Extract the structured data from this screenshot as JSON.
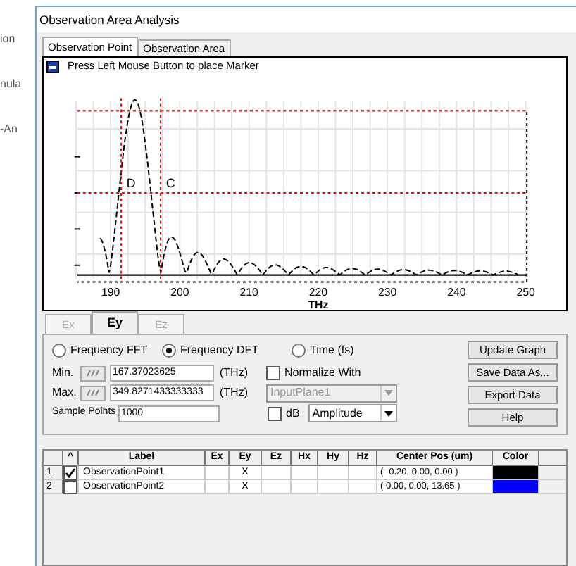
{
  "background_window": {
    "texts": [
      "ion",
      "nula",
      "-An"
    ]
  },
  "window": {
    "title": "Observation Area Analysis"
  },
  "tabs": [
    {
      "label": "Observation Point",
      "selected": true
    },
    {
      "label": "Observation Area",
      "selected": false
    }
  ],
  "graph": {
    "hint": "Press Left Mouse Button to place Marker",
    "x_tick_labels": [
      "190",
      "200",
      "210",
      "220",
      "230",
      "240",
      "250"
    ],
    "x_axis_label": "THz",
    "markers": [
      {
        "label": "D"
      },
      {
        "label": "C"
      }
    ]
  },
  "field_tabs": [
    {
      "label": "Ex",
      "selected": false,
      "disabled": true
    },
    {
      "label": "Ey",
      "selected": true,
      "disabled": false
    },
    {
      "label": "Ez",
      "selected": false,
      "disabled": true
    }
  ],
  "modes": [
    {
      "label": "Frequency FFT",
      "selected": false
    },
    {
      "label": "Frequency DFT",
      "selected": true
    },
    {
      "label": "Time (fs)",
      "selected": false
    }
  ],
  "range": [
    {
      "label": "Min.",
      "value": "167.37023625",
      "unit": "(THz)"
    },
    {
      "label": "Max.",
      "value": "349.8271433333333",
      "unit": "(THz)"
    }
  ],
  "sample_points": {
    "label": "Sample Points",
    "value": "1000"
  },
  "normalize": {
    "label": "Normalize With",
    "checked": false
  },
  "normalize_source": {
    "value": "InputPlane1",
    "disabled": true
  },
  "db": {
    "label": "dB",
    "checked": false
  },
  "quantity": {
    "value": "Amplitude"
  },
  "buttons": [
    "Update Graph",
    "Save Data As...",
    "Export Data",
    "Help"
  ],
  "table": {
    "columns": [
      "^",
      "Label",
      "Ex",
      "Ey",
      "Ez",
      "Hx",
      "Hy",
      "Hz",
      "Center Pos (um)",
      "Color"
    ],
    "rows": [
      {
        "index": "1",
        "checked": true,
        "label": "ObservationPoint1",
        "ey": "X",
        "center": "( -0.20, 0.00, 0.00 )",
        "color": "#000000"
      },
      {
        "index": "2",
        "checked": false,
        "label": "ObservationPoint2",
        "ey": "X",
        "center": "( 0.00, 0.00, 13.65 )",
        "color": "#0000ff"
      }
    ]
  }
}
